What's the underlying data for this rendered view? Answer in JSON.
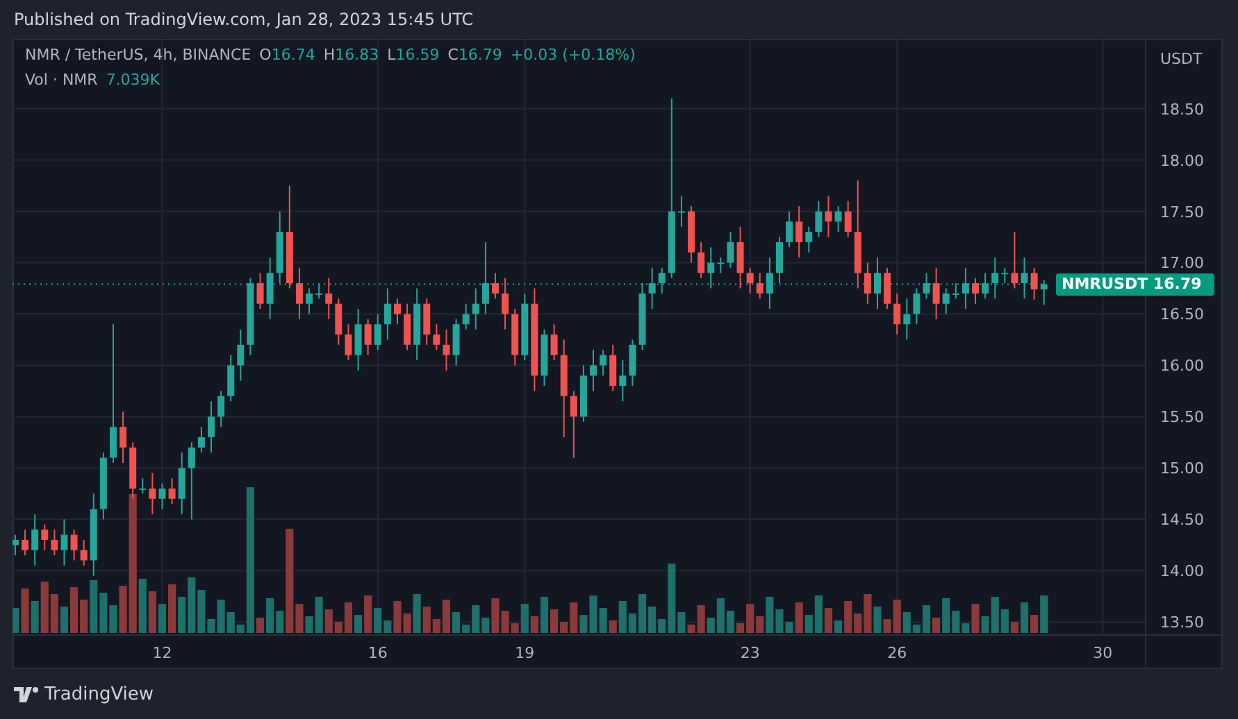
{
  "header": {
    "published": "Published on TradingView.com, Jan 28, 2023 15:45 UTC"
  },
  "legend": {
    "symbol": "NMR / TetherUS, 4h, BINANCE",
    "ohlc": [
      {
        "label": "O",
        "value": "16.74"
      },
      {
        "label": "H",
        "value": "16.83"
      },
      {
        "label": "L",
        "value": "16.59"
      },
      {
        "label": "C",
        "value": "16.79"
      }
    ],
    "change": "+0.03 (+0.18%)",
    "volume_label": "Vol · NMR",
    "volume_value": "7.039K"
  },
  "chart_data": {
    "type": "candlestick",
    "categories": [
      null,
      null,
      null,
      null,
      null,
      null,
      null,
      null,
      null,
      null,
      null,
      null,
      null,
      null,
      null,
      "12",
      null,
      null,
      null,
      null,
      null,
      null,
      null,
      null,
      null,
      null,
      null,
      null,
      null,
      null,
      null,
      null,
      null,
      null,
      null,
      null,
      null,
      "16",
      null,
      null,
      null,
      null,
      null,
      null,
      null,
      null,
      null,
      null,
      null,
      null,
      null,
      null,
      "19",
      null,
      null,
      null,
      null,
      null,
      null,
      null,
      null,
      null,
      null,
      null,
      null,
      null,
      null,
      null,
      null,
      null,
      null,
      null,
      null,
      null,
      null,
      "23",
      null,
      null,
      null,
      null,
      null,
      null,
      null,
      null,
      null,
      null,
      null,
      null,
      null,
      null,
      "26",
      null,
      null,
      null,
      null,
      null,
      null,
      null,
      null,
      null,
      null,
      null,
      null,
      null,
      null,
      null,
      null,
      null,
      null,
      null,
      null,
      "30"
    ],
    "ylim": [
      13.38,
      19.18
    ],
    "grid": true,
    "ref_lines": [
      {
        "axis": "y",
        "value": 16.79,
        "color": "#26a69a"
      }
    ],
    "ohlc": [
      [
        14.25,
        14.35,
        14.15,
        14.3
      ],
      [
        14.3,
        14.4,
        14.15,
        14.2
      ],
      [
        14.2,
        14.55,
        14.05,
        14.4
      ],
      [
        14.4,
        14.45,
        14.2,
        14.3
      ],
      [
        14.3,
        14.4,
        14.15,
        14.2
      ],
      [
        14.2,
        14.5,
        14.05,
        14.35
      ],
      [
        14.35,
        14.4,
        14.1,
        14.2
      ],
      [
        14.2,
        14.3,
        14.05,
        14.1
      ],
      [
        14.1,
        14.75,
        13.95,
        14.6
      ],
      [
        14.6,
        15.15,
        14.5,
        15.1
      ],
      [
        15.1,
        16.4,
        15.05,
        15.4
      ],
      [
        15.4,
        15.55,
        15.05,
        15.2
      ],
      [
        15.2,
        15.25,
        14.7,
        14.8
      ],
      [
        14.8,
        14.9,
        14.75,
        14.8
      ],
      [
        14.8,
        14.95,
        14.55,
        14.7
      ],
      [
        14.7,
        14.85,
        14.6,
        14.8
      ],
      [
        14.8,
        14.9,
        14.65,
        14.7
      ],
      [
        14.7,
        15.15,
        14.55,
        15.0
      ],
      [
        15.0,
        15.25,
        14.5,
        15.2
      ],
      [
        15.2,
        15.4,
        15.15,
        15.3
      ],
      [
        15.3,
        15.65,
        15.15,
        15.5
      ],
      [
        15.5,
        15.75,
        15.4,
        15.7
      ],
      [
        15.7,
        16.1,
        15.65,
        16.0
      ],
      [
        16.0,
        16.35,
        15.85,
        16.2
      ],
      [
        16.2,
        16.85,
        16.1,
        16.8
      ],
      [
        16.8,
        16.9,
        16.55,
        16.6
      ],
      [
        16.6,
        17.05,
        16.45,
        16.9
      ],
      [
        16.9,
        17.5,
        16.8,
        17.3
      ],
      [
        17.3,
        17.75,
        16.75,
        16.8
      ],
      [
        16.8,
        16.95,
        16.45,
        16.6
      ],
      [
        16.6,
        16.75,
        16.5,
        16.7
      ],
      [
        16.7,
        16.8,
        16.65,
        16.7
      ],
      [
        16.7,
        16.85,
        16.45,
        16.6
      ],
      [
        16.6,
        16.65,
        16.2,
        16.3
      ],
      [
        16.3,
        16.4,
        16.05,
        16.1
      ],
      [
        16.1,
        16.55,
        15.95,
        16.4
      ],
      [
        16.4,
        16.45,
        16.1,
        16.2
      ],
      [
        16.2,
        16.5,
        16.15,
        16.4
      ],
      [
        16.4,
        16.75,
        16.25,
        16.6
      ],
      [
        16.6,
        16.65,
        16.4,
        16.5
      ],
      [
        16.5,
        16.6,
        16.15,
        16.2
      ],
      [
        16.2,
        16.75,
        16.05,
        16.6
      ],
      [
        16.6,
        16.65,
        16.2,
        16.3
      ],
      [
        16.3,
        16.4,
        16.15,
        16.2
      ],
      [
        16.2,
        16.35,
        15.95,
        16.1
      ],
      [
        16.1,
        16.45,
        16.0,
        16.4
      ],
      [
        16.4,
        16.6,
        16.35,
        16.5
      ],
      [
        16.5,
        16.75,
        16.35,
        16.6
      ],
      [
        16.6,
        17.2,
        16.5,
        16.8
      ],
      [
        16.8,
        16.9,
        16.65,
        16.7
      ],
      [
        16.7,
        16.85,
        16.35,
        16.5
      ],
      [
        16.5,
        16.55,
        16.0,
        16.1
      ],
      [
        16.1,
        16.7,
        16.05,
        16.6
      ],
      [
        16.6,
        16.75,
        15.75,
        15.9
      ],
      [
        15.9,
        16.35,
        15.8,
        16.3
      ],
      [
        16.3,
        16.4,
        16.05,
        16.1
      ],
      [
        16.1,
        16.25,
        15.3,
        15.7
      ],
      [
        15.7,
        15.75,
        15.1,
        15.5
      ],
      [
        15.5,
        16.0,
        15.45,
        15.9
      ],
      [
        15.9,
        16.15,
        15.75,
        16.0
      ],
      [
        16.0,
        16.15,
        15.9,
        16.1
      ],
      [
        16.1,
        16.2,
        15.75,
        15.8
      ],
      [
        15.8,
        16.05,
        15.65,
        15.9
      ],
      [
        15.9,
        16.25,
        15.8,
        16.2
      ],
      [
        16.2,
        16.8,
        16.15,
        16.7
      ],
      [
        16.7,
        16.95,
        16.55,
        16.8
      ],
      [
        16.8,
        16.95,
        16.7,
        16.9
      ],
      [
        16.9,
        18.6,
        16.85,
        17.5
      ],
      [
        17.5,
        17.65,
        17.35,
        17.5
      ],
      [
        17.5,
        17.55,
        17.0,
        17.1
      ],
      [
        17.1,
        17.2,
        16.85,
        16.9
      ],
      [
        16.9,
        17.15,
        16.75,
        17.0
      ],
      [
        17.0,
        17.05,
        16.9,
        17.0
      ],
      [
        17.0,
        17.3,
        16.95,
        17.2
      ],
      [
        17.2,
        17.35,
        16.75,
        16.9
      ],
      [
        16.9,
        16.95,
        16.7,
        16.8
      ],
      [
        16.8,
        16.9,
        16.65,
        16.7
      ],
      [
        16.7,
        17.05,
        16.55,
        16.9
      ],
      [
        16.9,
        17.25,
        16.8,
        17.2
      ],
      [
        17.2,
        17.5,
        17.15,
        17.4
      ],
      [
        17.4,
        17.55,
        17.05,
        17.2
      ],
      [
        17.2,
        17.35,
        17.1,
        17.3
      ],
      [
        17.3,
        17.6,
        17.25,
        17.5
      ],
      [
        17.5,
        17.65,
        17.25,
        17.4
      ],
      [
        17.4,
        17.55,
        17.3,
        17.5
      ],
      [
        17.5,
        17.6,
        17.25,
        17.3
      ],
      [
        17.3,
        17.8,
        16.75,
        16.9
      ],
      [
        16.9,
        17.0,
        16.6,
        16.7
      ],
      [
        16.7,
        17.05,
        16.55,
        16.9
      ],
      [
        16.9,
        16.95,
        16.55,
        16.6
      ],
      [
        16.6,
        16.7,
        16.3,
        16.4
      ],
      [
        16.4,
        16.65,
        16.25,
        16.5
      ],
      [
        16.5,
        16.75,
        16.4,
        16.7
      ],
      [
        16.7,
        16.9,
        16.65,
        16.8
      ],
      [
        16.8,
        16.95,
        16.45,
        16.6
      ],
      [
        16.6,
        16.75,
        16.5,
        16.7
      ],
      [
        16.7,
        16.8,
        16.65,
        16.7
      ],
      [
        16.7,
        16.95,
        16.55,
        16.8
      ],
      [
        16.8,
        16.85,
        16.6,
        16.7
      ],
      [
        16.7,
        16.9,
        16.65,
        16.8
      ],
      [
        16.8,
        17.05,
        16.65,
        16.9
      ],
      [
        16.9,
        16.95,
        16.8,
        16.9
      ],
      [
        16.9,
        17.3,
        16.75,
        16.8
      ],
      [
        16.8,
        17.05,
        16.65,
        16.9
      ],
      [
        16.9,
        16.95,
        16.64,
        16.74
      ],
      [
        16.74,
        16.83,
        16.59,
        16.79
      ],
      null,
      null,
      null,
      null,
      null,
      null
    ],
    "ylabel": "USDT",
    "yticks": [
      {
        "value": 18.5,
        "label": "18.50"
      },
      {
        "value": 18,
        "label": "18.00"
      },
      {
        "value": 17.5,
        "label": "17.50"
      },
      {
        "value": 17,
        "label": "17.00"
      },
      {
        "value": 16.5,
        "label": "16.50"
      },
      {
        "value": 16,
        "label": "16.00"
      },
      {
        "value": 15.5,
        "label": "15.50"
      },
      {
        "value": 15,
        "label": "15.00"
      },
      {
        "value": 14.5,
        "label": "14.50"
      },
      {
        "value": 14,
        "label": "14.00"
      },
      {
        "value": 13.5,
        "label": "13.50"
      }
    ]
  },
  "last_price": {
    "symbol": "NMRUSDT",
    "price": "16.79"
  },
  "footer": {
    "brand": "TradingView"
  }
}
